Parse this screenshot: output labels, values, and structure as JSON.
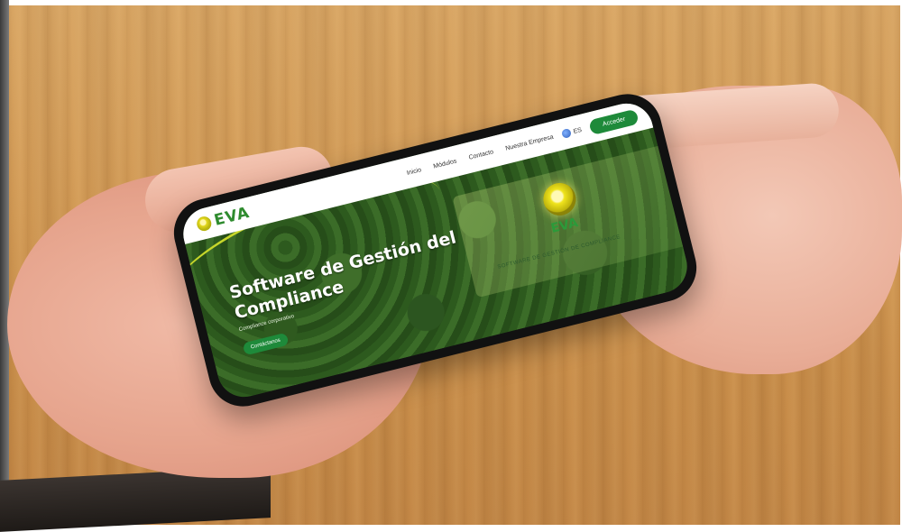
{
  "scene": {
    "description_hidden": false
  },
  "site": {
    "logo_text": "EVA",
    "nav": {
      "items": [
        "Inicio",
        "Módulos",
        "Contacto",
        "Nuestra Empresa"
      ],
      "language": "ES",
      "access_label": "Acceder"
    },
    "hero": {
      "title_line1": "Software de Gestión del",
      "title_line2": "Compliance",
      "subtitle": "Compliance corporativo",
      "cta_label": "Contáctanos"
    },
    "overlay": {
      "logo_text": "EVA",
      "caption": "SOFTWARE DE GESTIÓN DE COMPLIANCE"
    }
  },
  "colors": {
    "brand_green": "#1e8a3a",
    "logo_yellow": "#e4d91d"
  }
}
